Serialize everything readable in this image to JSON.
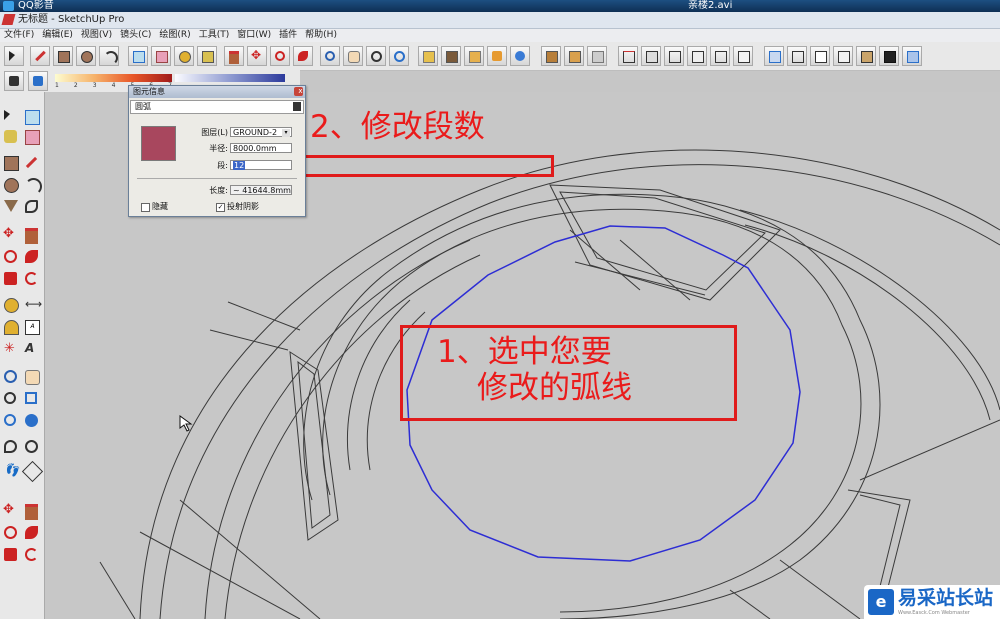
{
  "player": {
    "title": "QQ影音",
    "video_name": "亲楼2.avi"
  },
  "window": {
    "title": "无标题 - SketchUp Pro"
  },
  "menu": [
    "文件(F)",
    "编辑(E)",
    "视图(V)",
    "镜头(C)",
    "绘图(R)",
    "工具(T)",
    "窗口(W)",
    "插件",
    "帮助(H)"
  ],
  "palette_scale": [
    "1",
    "2",
    "3",
    "4",
    "5",
    "6",
    "7"
  ],
  "dialog": {
    "title": "图元信息",
    "entity_type": "圆弧",
    "layer_label": "图层(L)",
    "layer_value": "GROUND-2",
    "radius_label": "半径:",
    "radius_value": "8000.0mm",
    "segments_label": "段:",
    "segments_value": "12",
    "length_label": "长度:",
    "length_value": "~ 41644.8mm",
    "hidden_label": "隐藏",
    "hidden_checked": false,
    "cast_shadow_label": "投射阴影",
    "cast_shadow_checked": true,
    "close_glyph": "x",
    "dropdown_glyph": "▾"
  },
  "annotations": {
    "step2": "2、修改段数",
    "step1_line1": "1、选中您要",
    "step1_line2": "修改的弧线",
    "color": "#e01b1b"
  },
  "watermark": {
    "logo_glyph": "e",
    "name": "易采站长站",
    "sub": "Www.Easck.Com Webmaster"
  },
  "colors": {
    "selected_arc": "#2d2dd4",
    "material_swatch": "#a8475e",
    "model_lines": "#3a3a3a",
    "viewport_bg": "#c7c7c7"
  }
}
